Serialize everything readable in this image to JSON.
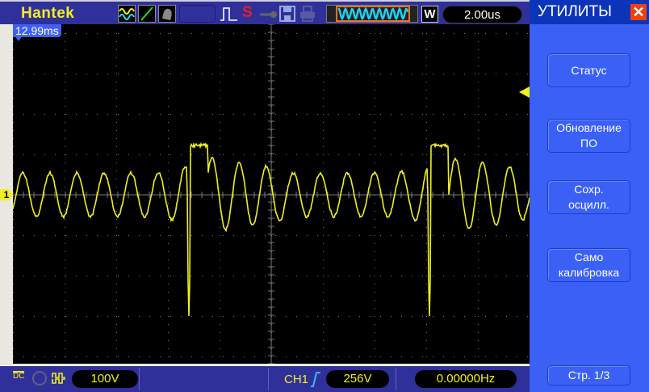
{
  "header": {
    "brand": "Hantek",
    "timebase": "2.00us",
    "wave_mode": "W",
    "run_state": "S"
  },
  "screen": {
    "trigger_time": "12.99ms",
    "channel_marker": "1"
  },
  "footer": {
    "coupling": "DC",
    "volts_div": "100V",
    "trigger_channel": "CH1",
    "trigger_level": "256V",
    "frequency": "0.00000Hz"
  },
  "menu": {
    "title": "УТИЛИТЫ",
    "buttons": [
      {
        "label": "Статус"
      },
      {
        "label": "Обновление ПО"
      },
      {
        "label": "Сохр. осцилл."
      },
      {
        "label": "Само калибровка"
      }
    ],
    "page": "Стр.  1/3"
  },
  "colors": {
    "trace": "#f0f020",
    "panel": "#3a60f5",
    "bar": "#30309a"
  }
}
